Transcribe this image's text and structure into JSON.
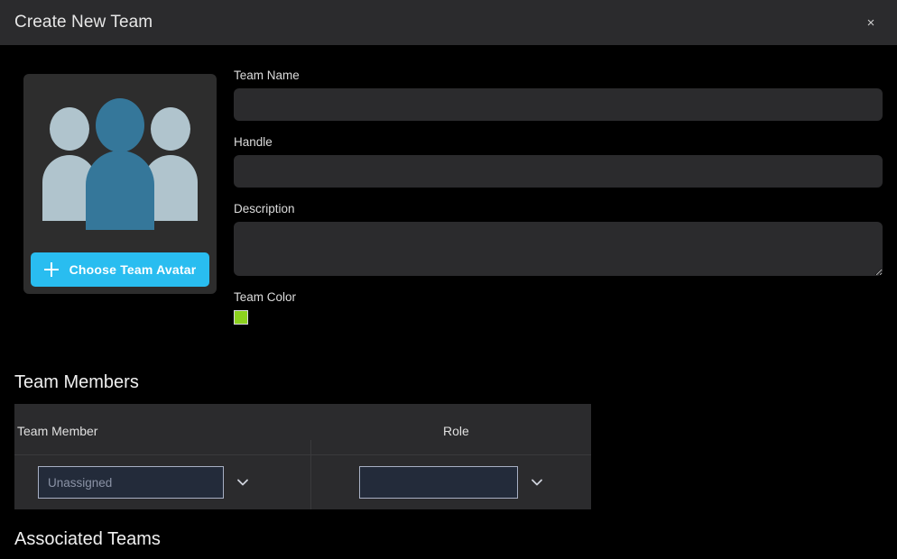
{
  "header": {
    "title": "Create New Team",
    "close_label": "×",
    "close_icon": "close-icon",
    "background": "#2b2b2d"
  },
  "avatar": {
    "icon": "team-people-icon",
    "button_label": "Choose Team Avatar",
    "button_icon": "plus-icon",
    "button_color": "#29bdf0",
    "figure_front_color": "#35779a",
    "figure_side_color": "#b0c4cd",
    "card_background": "#2d2d2d"
  },
  "form": {
    "fields": [
      {
        "label": "Team Name",
        "value": "",
        "placeholder": "",
        "type": "text"
      },
      {
        "label": "Handle",
        "value": "",
        "placeholder": "",
        "type": "text"
      },
      {
        "label": "Description",
        "value": "",
        "placeholder": "",
        "type": "textarea"
      }
    ],
    "team_color": {
      "label": "Team Color",
      "value": "#8cd11f",
      "border": "#d6d6de"
    }
  },
  "team_members": {
    "heading": "Team Members",
    "columns": [
      "Team Member",
      "Role"
    ],
    "rows": [
      {
        "member_value": "",
        "member_placeholder": "Unassigned",
        "role_value": "",
        "role_placeholder": "",
        "dropdown_icon": "chevron-down-icon"
      }
    ],
    "panel_background": "#2b2b2d",
    "select_background": "#232b3a",
    "select_border": "#a8b0c4"
  },
  "associated_teams": {
    "heading": "Associated Teams"
  }
}
